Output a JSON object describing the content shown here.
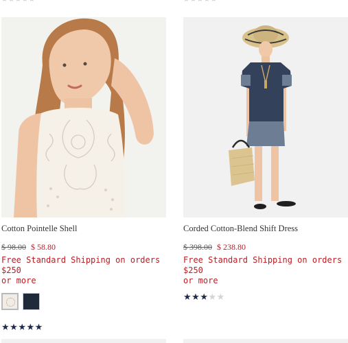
{
  "top_rating_left": "★★★★★",
  "top_rating_right": "★★★★★",
  "products": [
    {
      "title": "Cotton Pointelle Shell",
      "original_price": "$ 98.00",
      "sale_price": "$ 58.80",
      "shipping_line1": "Free Standard Shipping on orders $250",
      "shipping_line2": "or more",
      "swatches": [
        "ivory",
        "navy"
      ],
      "rating": 5,
      "rating_max": 5
    },
    {
      "title": "Corded Cotton-Blend Shift Dress",
      "original_price": "$ 398.00",
      "sale_price": "$ 238.80",
      "shipping_line1": "Free Standard Shipping on orders $250",
      "shipping_line2": "or more",
      "rating": 3,
      "rating_max": 5
    }
  ],
  "colors": {
    "sale": "#b81d24",
    "rating_filled": "#1e2a48",
    "rating_empty": "#d4d4d4"
  }
}
